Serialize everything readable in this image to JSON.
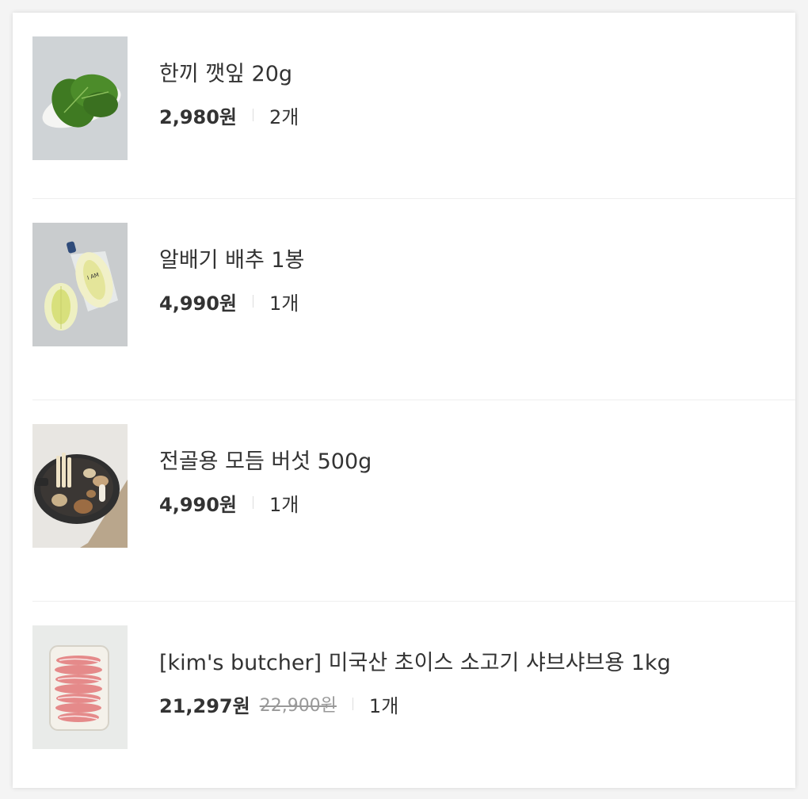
{
  "items": [
    {
      "name": "한끼 깻잎 20g",
      "price": "2,980원",
      "original_price": "",
      "quantity": "2개",
      "thumbnail": "perilla-leaves-image"
    },
    {
      "name": "알배기 배추 1봉",
      "price": "4,990원",
      "original_price": "",
      "quantity": "1개",
      "thumbnail": "napa-cabbage-image"
    },
    {
      "name": "전골용 모듬 버섯 500g",
      "price": "4,990원",
      "original_price": "",
      "quantity": "1개",
      "thumbnail": "mushroom-hotpot-image"
    },
    {
      "name": "[kim's butcher] 미국산 초이스 소고기 샤브샤브용 1kg",
      "price": "21,297원",
      "original_price": "22,900원",
      "quantity": "1개",
      "thumbnail": "sliced-beef-image"
    }
  ]
}
